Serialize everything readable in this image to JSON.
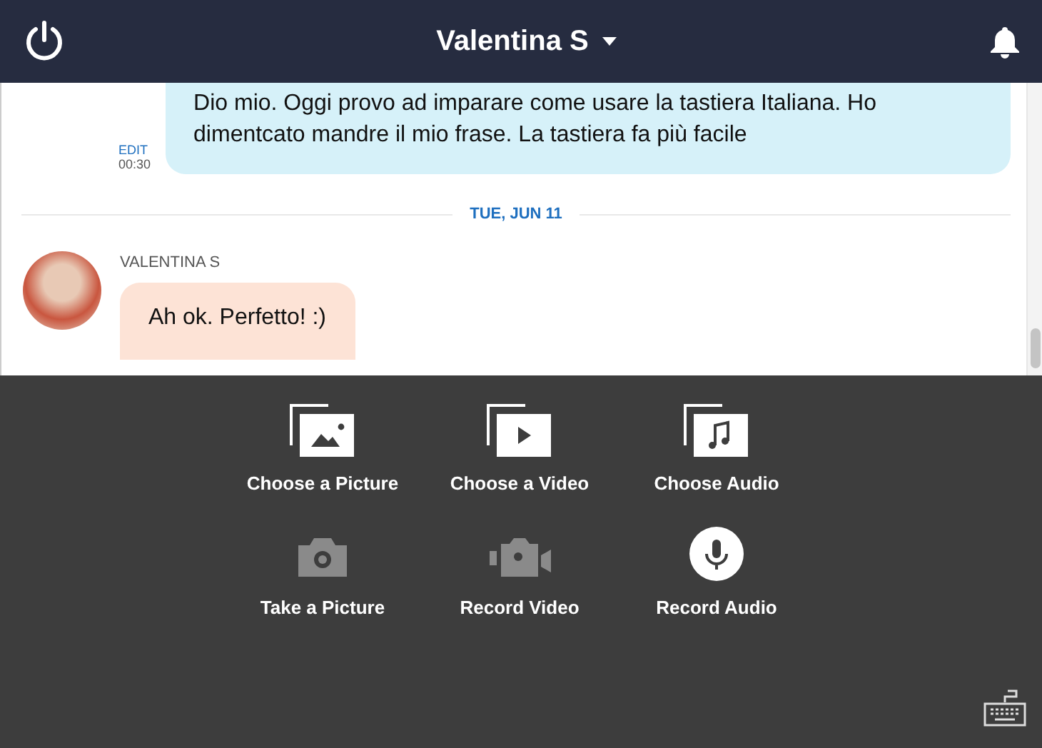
{
  "header": {
    "title": "Valentina S"
  },
  "messages": [
    {
      "kind": "sent",
      "text": "Dio mio. Oggi provo ad imparare come usare la tastiera Italiana. Ho dimentcato mandre il mio frase. La tastiera fa più facile",
      "edit": "EDIT",
      "time": "00:30"
    },
    {
      "kind": "date",
      "text": "TUE, JUN 11"
    },
    {
      "kind": "received",
      "sender": "VALENTINA S",
      "text": "Ah ok. Perfetto! :)"
    }
  ],
  "actions": [
    {
      "kind": "picture",
      "label": "Choose a Picture",
      "disabled": false
    },
    {
      "kind": "video",
      "label": "Choose a Video",
      "disabled": false
    },
    {
      "kind": "audio",
      "label": "Choose Audio",
      "disabled": false
    },
    {
      "kind": "camera",
      "label": "Take a Picture",
      "disabled": true
    },
    {
      "kind": "recorder",
      "label": "Record Video",
      "disabled": true
    },
    {
      "kind": "mic",
      "label": "Record Audio",
      "disabled": false
    }
  ]
}
